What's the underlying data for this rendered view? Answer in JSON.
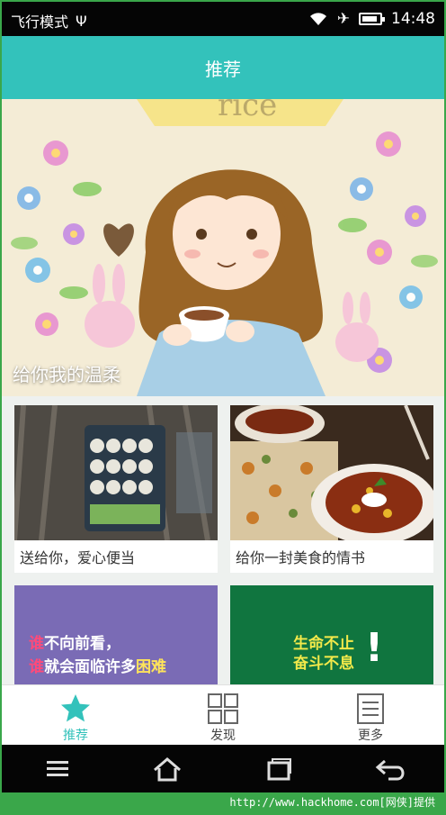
{
  "status": {
    "mode": "飞行模式",
    "usb": "Ψ",
    "time": "14:48"
  },
  "header": {
    "title": "推荐"
  },
  "banner": {
    "caption": "给你我的温柔",
    "art_text": "rice"
  },
  "cards": [
    {
      "label": "送给你，爱心便当"
    },
    {
      "label": "给你一封美食的情书"
    },
    {
      "line1_red": "谁",
      "line1_rest": "不向前看，",
      "line2_red": "谁",
      "line2_mid": "就会面临许多",
      "line2_end": "困难"
    },
    {
      "line1": "生命不止",
      "line2": "奋斗不息",
      "mark": "!"
    }
  ],
  "tabs": [
    {
      "label": "推荐",
      "icon": "star-icon",
      "active": true
    },
    {
      "label": "发现",
      "icon": "grid-icon",
      "active": false
    },
    {
      "label": "更多",
      "icon": "document-icon",
      "active": false
    }
  ],
  "watermark": "http://www.hackhome.com[网侠]提供",
  "colors": {
    "accent": "#33c2bb",
    "statusbar": "#050505",
    "frame": "#3aa74a"
  }
}
